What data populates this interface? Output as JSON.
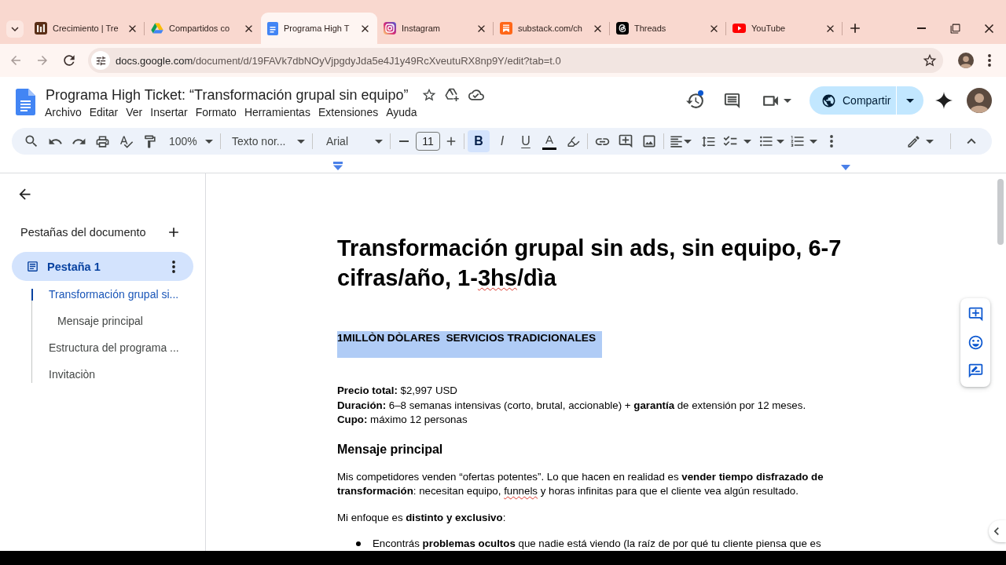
{
  "browser": {
    "tabs": [
      {
        "title": "Crecimiento | Tre",
        "selected": false
      },
      {
        "title": "Compartidos co",
        "selected": false
      },
      {
        "title": "Programa High T",
        "selected": true
      },
      {
        "title": "Instagram",
        "selected": false
      },
      {
        "title": "substack.com/ch",
        "selected": false
      },
      {
        "title": "Threads",
        "selected": false
      },
      {
        "title": "YouTube",
        "selected": false
      }
    ],
    "back_disabled": true,
    "forward_disabled": true,
    "url_host": "docs.google.com",
    "url_path": "/document/d/19FAVk7dbNOyVjpgdyJda5e4J1y49RcXveutuRX8np9Y/edit?tab=t.0"
  },
  "docs_header": {
    "title": "Programa High Ticket: “Transformación grupal sin equipo”",
    "menu": [
      "Archivo",
      "Editar",
      "Ver",
      "Insertar",
      "Formato",
      "Herramientas",
      "Extensiones",
      "Ayuda"
    ],
    "history_notification": true,
    "share_label": "Compartir"
  },
  "toolbar": {
    "zoom": "100%",
    "paragraph_style": "Texto nor...",
    "font": "Arial",
    "font_size": "11",
    "format_buttons": [
      {
        "kind": "bold",
        "label": "B",
        "selected": true
      },
      {
        "kind": "italic",
        "label": "I",
        "selected": false
      },
      {
        "kind": "underline",
        "label": "U",
        "selected": false
      }
    ],
    "text_color_label": "A"
  },
  "sidebar": {
    "heading": "Pestañas del documento",
    "tabs": [
      {
        "label": "Pestaña 1",
        "selected": true,
        "outline": [
          {
            "label": "Transformación grupal si...",
            "selected": true,
            "children": [
              {
                "label": "Mensaje principal",
                "selected": false
              }
            ]
          },
          {
            "label": "Estructura del programa ...",
            "selected": false
          },
          {
            "label": "Invitaciòn",
            "selected": false
          }
        ]
      }
    ]
  },
  "document": {
    "blocks": [
      {
        "kind": "title",
        "selected": false,
        "segments": [
          {
            "text": "Transformación grupal sin ads, sin equipo, 6-7 cifras/año, 1-",
            "misspelled": false
          },
          {
            "text": "3hs",
            "misspelled": true
          },
          {
            "text": "/dìa",
            "misspelled": false
          }
        ]
      },
      {
        "kind": "heading",
        "selected": true,
        "segments": [
          {
            "text": "1MILLÒN DÒLARES  SERVICIOS TRADICIONALES",
            "misspelled": false
          }
        ]
      },
      {
        "kind": "line",
        "selected": false,
        "segments": [
          {
            "text": "**Precio total:** $2,997 USD",
            "misspelled": false
          }
        ]
      },
      {
        "kind": "line",
        "selected": false,
        "segments": [
          {
            "text": "**Duración:** 6–8 semanas intensivas (corto, brutal, accionable) + **garantía** de extensión por 12 meses.",
            "misspelled": false
          }
        ]
      },
      {
        "kind": "line",
        "selected": false,
        "segments": [
          {
            "text": "**Cupo:** máximo 12 personas",
            "misspelled": false
          }
        ]
      },
      {
        "kind": "subheading",
        "selected": false,
        "segments": [
          {
            "text": "Mensaje principal",
            "misspelled": false
          }
        ]
      },
      {
        "kind": "paragraph",
        "selected": false,
        "segments": [
          {
            "text": "Mis competidores venden “ofertas potentes”. Lo que hacen en realidad es **vender tiempo disfrazado de transformación**: necesitan equipo, ",
            "misspelled": false
          },
          {
            "text": "funnels",
            "misspelled": true
          },
          {
            "text": " y horas infinitas para que el cliente vea algún resultado.",
            "misspelled": false
          }
        ]
      },
      {
        "kind": "paragraph",
        "selected": false,
        "segments": [
          {
            "text": "Mi enfoque es **distinto y exclusivo**:",
            "misspelled": false
          }
        ]
      },
      {
        "kind": "bullet",
        "selected": false,
        "segments": [
          {
            "text": "Encontrás **problemas ocultos** que nadie está viendo (la raíz de por qué tu cliente piensa que es",
            "misspelled": false
          }
        ]
      }
    ]
  }
}
